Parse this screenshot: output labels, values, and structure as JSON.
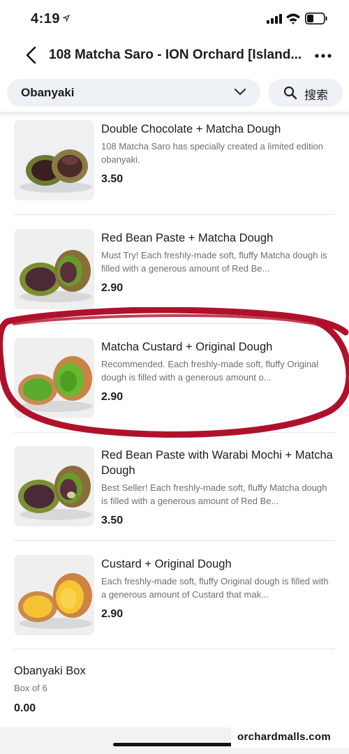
{
  "status_bar": {
    "time": "4:19"
  },
  "header": {
    "title": "108 Matcha Saro - ION Orchard [Island..."
  },
  "filter": {
    "category": "Obanyaki",
    "search_label": "搜索"
  },
  "items": [
    {
      "name": "Double Chocolate + Matcha Dough",
      "description": "108 Matcha Saro has specially created a limited edition obanyaki.",
      "price": "3.50",
      "image": "obanyaki-chocolate-matcha"
    },
    {
      "name": "Red Bean Paste + Matcha Dough",
      "description": "Must Try! Each freshly-made soft, fluffy Matcha dough is filled with a generous amount of Red Be...",
      "price": "2.90",
      "image": "obanyaki-redbean-matcha"
    },
    {
      "name": "Matcha Custard + Original Dough",
      "description": "Recommended. Each freshly-made soft, fluffy Original dough is filled with a generous amount o...",
      "price": "2.90",
      "image": "obanyaki-matcha-custard"
    },
    {
      "name": "Red Bean Paste with Warabi Mochi + Matcha Dough",
      "description": "Best Seller! Each freshly-made soft, fluffy Matcha dough is filled with a generous amount of Red Be...",
      "price": "3.50",
      "image": "obanyaki-redbean-mochi"
    },
    {
      "name": "Custard + Original Dough",
      "description": "Each freshly-made soft, fluffy Original dough is filled with a generous amount of Custard that mak...",
      "price": "2.90",
      "image": "obanyaki-custard"
    }
  ],
  "box_item": {
    "name": "Obanyaki Box",
    "subtitle": "Box of 6",
    "price": "0.00"
  },
  "watermark": "orchardmalls.com",
  "colors": {
    "annotation_red": "#b0112a",
    "filter_bg": "#eef1f6"
  }
}
